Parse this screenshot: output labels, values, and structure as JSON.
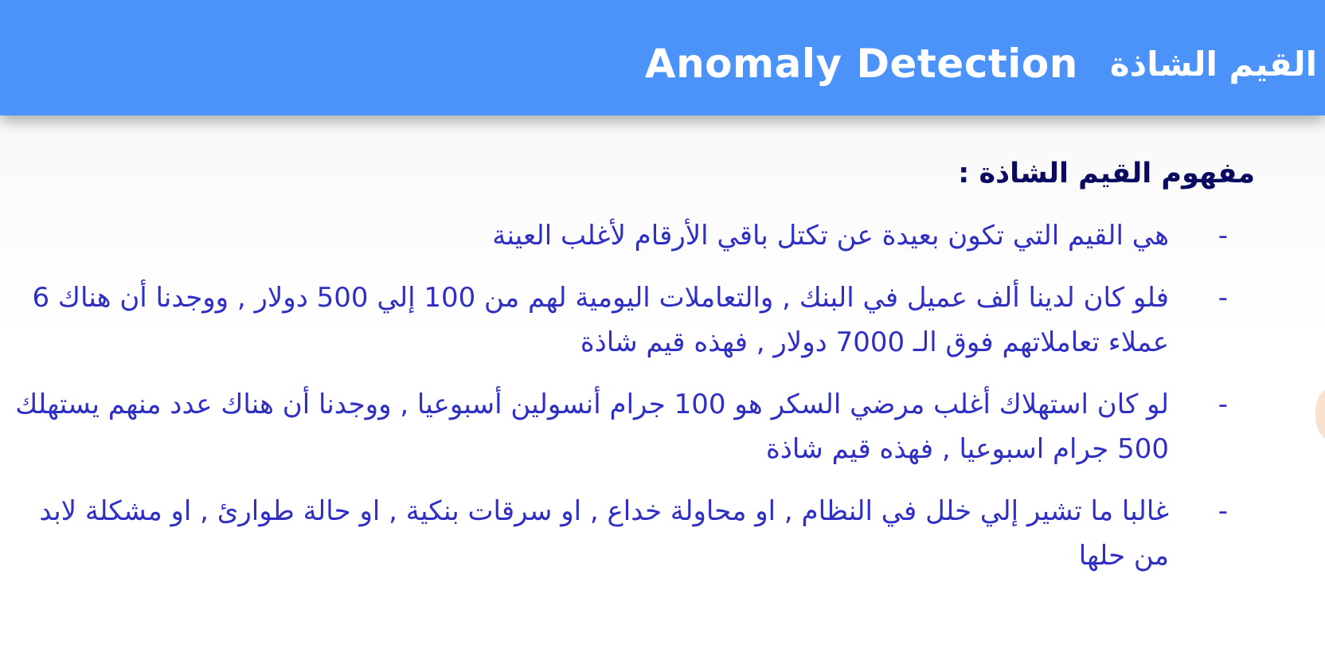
{
  "header": {
    "title_ar": "القيم الشاذة",
    "title_en": "Anomaly Detection"
  },
  "content": {
    "heading": "مفهوم القيم الشاذة  :",
    "bullet_marker": "-",
    "bullets": [
      "هي القيم التي تكون بعيدة عن تكتل باقي الأرقام لأغلب العينة",
      "فلو كان لدينا ألف عميل في البنك , والتعاملات اليومية لهم من 100 إلي 500 دولار , ووجدنا أن هناك 6 عملاء تعاملاتهم فوق الـ 7000 دولار , فهذه قيم شاذة",
      "لو كان استهلاك أغلب مرضي السكر هو 100 جرام أنسولين أسبوعيا , ووجدنا أن هناك عدد منهم يستهلك 500 جرام اسبوعيا , فهذه قيم شاذة",
      "غالبا ما تشير إلي خلل في النظام , او محاولة خداع , او سرقات بنكية , او حالة طوارئ , او مشكلة لابد من حلها"
    ]
  }
}
